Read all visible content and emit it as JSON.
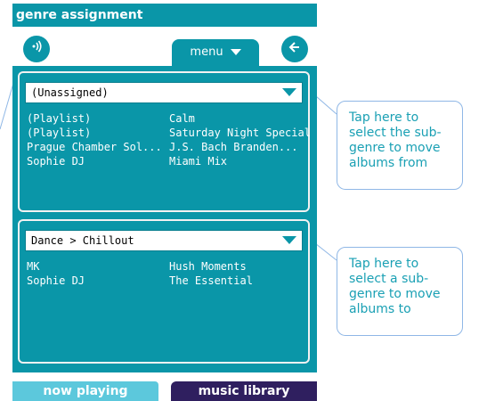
{
  "title": "genre assignment",
  "toolbar": {
    "left_icon": "speaker-icon",
    "menu_label": "menu",
    "back_icon": "arrow-left-icon"
  },
  "source_panel": {
    "dropdown_value": "(Unassigned)",
    "rows": [
      {
        "col1": "(Playlist)",
        "col2": "Calm"
      },
      {
        "col1": "(Playlist)",
        "col2": "Saturday Night Special"
      },
      {
        "col1": "Prague Chamber Sol...",
        "col2": "J.S. Bach Branden..."
      },
      {
        "col1": "Sophie DJ",
        "col2": "Miami Mix"
      }
    ]
  },
  "target_panel": {
    "dropdown_value": "Dance > Chillout",
    "rows": [
      {
        "col1": "MK",
        "col2": "Hush Moments"
      },
      {
        "col1": "Sophie DJ",
        "col2": "The Essential"
      }
    ]
  },
  "tabs": {
    "now_playing": "now playing",
    "music_library": "music library"
  },
  "callouts": {
    "top": [
      "Tap here to",
      "select the sub-",
      "genre to move",
      "albums from"
    ],
    "bottom": [
      "Tap here to",
      "select a sub-",
      "genre to move",
      "albums to"
    ]
  },
  "colors": {
    "primary": "#0a96a8",
    "tab_active": "#2f1f5f",
    "tab_inactive": "#5cc8dc",
    "callout_text": "#1aa0b4",
    "callout_border": "#8fb7e6"
  }
}
